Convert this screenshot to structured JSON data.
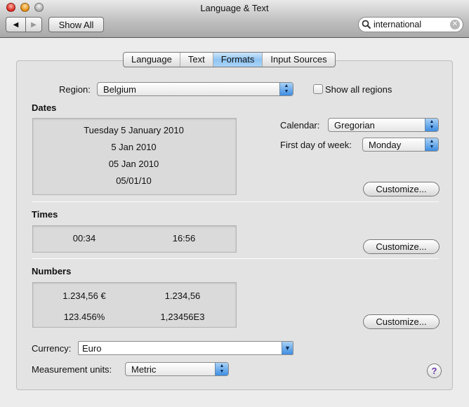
{
  "window": {
    "title": "Language & Text"
  },
  "toolbar": {
    "back": "◀",
    "forward": "▶",
    "show_all": "Show All",
    "search_value": "international",
    "search_icon": "magnifier-icon",
    "clear_icon": "clear-icon"
  },
  "tabs": [
    {
      "label": "Language"
    },
    {
      "label": "Text"
    },
    {
      "label": "Formats",
      "selected": true
    },
    {
      "label": "Input Sources"
    }
  ],
  "region": {
    "label": "Region:",
    "value": "Belgium",
    "show_all_label": "Show all regions",
    "show_all_checked": false
  },
  "dates": {
    "heading": "Dates",
    "samples": [
      "Tuesday 5 January 2010",
      "5 Jan 2010",
      "05 Jan 2010",
      "05/01/10"
    ],
    "calendar_label": "Calendar:",
    "calendar_value": "Gregorian",
    "first_day_label": "First day of week:",
    "first_day_value": "Monday",
    "customize": "Customize..."
  },
  "times": {
    "heading": "Times",
    "samples": [
      "00:34",
      "16:56"
    ],
    "customize": "Customize..."
  },
  "numbers": {
    "heading": "Numbers",
    "samples": [
      "1.234,56 €",
      "1.234,56",
      "123.456%",
      "1,23456E3"
    ],
    "customize": "Customize..."
  },
  "currency": {
    "label": "Currency:",
    "value": "Euro"
  },
  "measurement": {
    "label": "Measurement units:",
    "value": "Metric"
  },
  "help": {
    "label": "?"
  },
  "colors": {
    "accent": "#5fa5ec"
  }
}
